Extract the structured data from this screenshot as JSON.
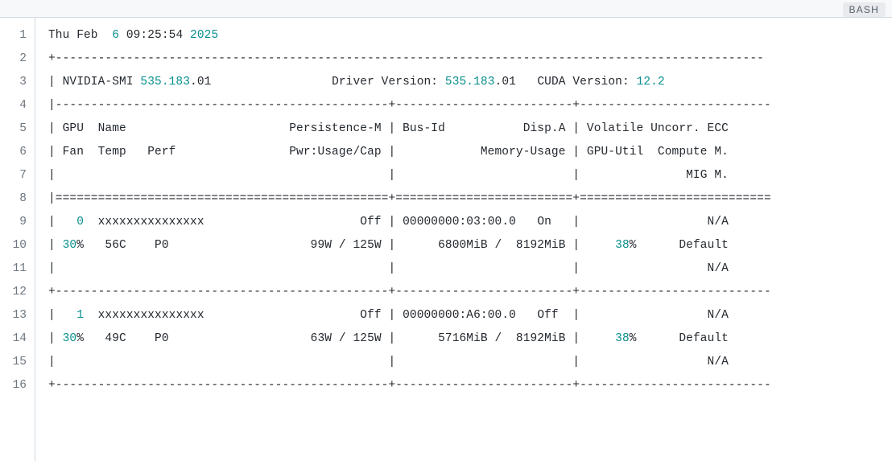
{
  "lang_badge": "BASH",
  "line_count": 16,
  "header": {
    "weekday": "Thu",
    "month": "Feb",
    "day": "6",
    "time": "09:25:54",
    "year": "2025"
  },
  "smi": {
    "label": "NVIDIA-SMI",
    "version_numeric": "535.183",
    "version_suffix": ".01",
    "driver_label": "Driver Version:",
    "driver_numeric": "535.183",
    "driver_suffix": ".01",
    "cuda_label": "CUDA Version:",
    "cuda_version": "12.2"
  },
  "cols": {
    "gpu": "GPU",
    "name": "Name",
    "persist": "Persistence-M",
    "busid": "Bus-Id",
    "disp": "Disp.A",
    "vuecc": "Volatile Uncorr. ECC",
    "fan": "Fan",
    "temp": "Temp",
    "perf": "Perf",
    "pwr": "Pwr:Usage/Cap",
    "memuse": "Memory-Usage",
    "gpuutil": "GPU-Util",
    "compm": "Compute M.",
    "migm": "MIG M."
  },
  "gpus": [
    {
      "id": "0",
      "name": "xxxxxxxxxxxxxxx",
      "persist": "Off",
      "busid": "00000000:03:00.0",
      "disp": "On",
      "ecc": "N/A",
      "fan": "30",
      "fan_suffix": "%",
      "temp": "56C",
      "perf": "P0",
      "pwr": "99W / 125W",
      "mem": "6800MiB /  8192MiB",
      "util": "38",
      "util_suffix": "%",
      "comp": "Default",
      "mig": "N/A"
    },
    {
      "id": "1",
      "name": "xxxxxxxxxxxxxxx",
      "persist": "Off",
      "busid": "00000000:A6:00.0",
      "disp": "Off",
      "ecc": "N/A",
      "fan": "30",
      "fan_suffix": "%",
      "temp": "49C",
      "perf": "P0",
      "pwr": "63W / 125W",
      "mem": "5716MiB /  8192MiB",
      "util": "38",
      "util_suffix": "%",
      "comp": "Default",
      "mig": "N/A"
    }
  ],
  "seg": {
    "plus": "+",
    "dash48": "-----------------------------------------------",
    "dash26": "-------------------------",
    "dash_rest": "--------------------------",
    "eq48": "===============================================",
    "eq26": "=========================",
    "eq_rest": "==========================",
    "pipe": "|"
  }
}
